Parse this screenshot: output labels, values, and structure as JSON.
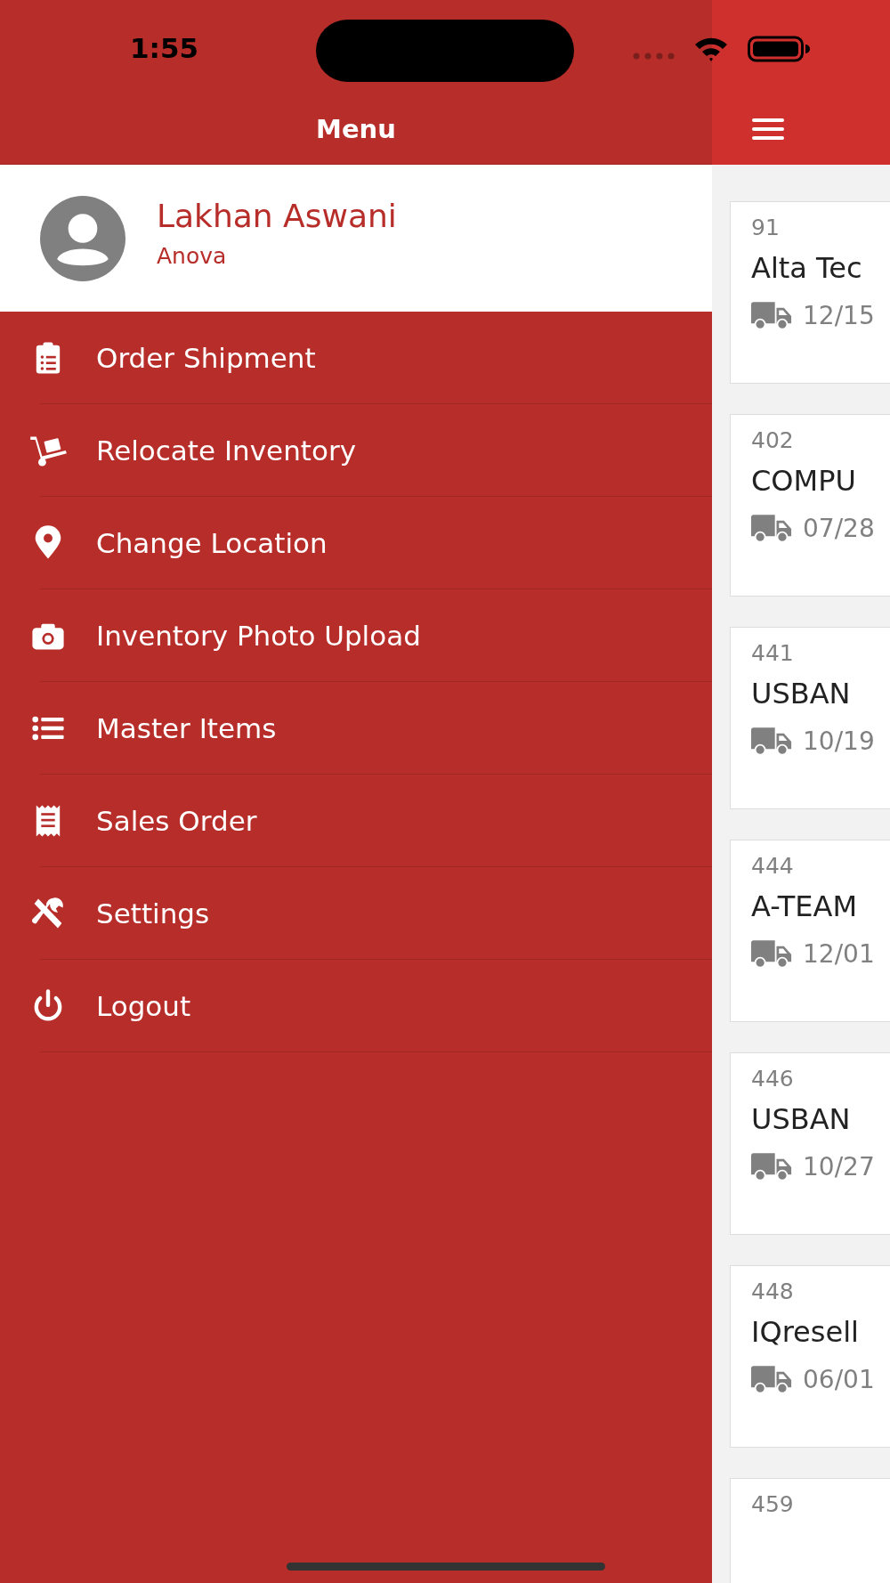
{
  "status_bar": {
    "time": "1:55"
  },
  "drawer": {
    "title": "Menu",
    "user": {
      "name": "Lakhan Aswani",
      "company": "Anova"
    },
    "items": [
      {
        "label": "Order Shipment",
        "kind": "clipboard"
      },
      {
        "label": "Relocate Inventory",
        "kind": "dolly"
      },
      {
        "label": "Change Location",
        "kind": "pin"
      },
      {
        "label": "Inventory Photo Upload",
        "kind": "camera"
      },
      {
        "label": "Master Items",
        "kind": "list"
      },
      {
        "label": "Sales Order",
        "kind": "receipt"
      },
      {
        "label": "Settings",
        "kind": "tools"
      },
      {
        "label": "Logout",
        "kind": "power"
      }
    ]
  },
  "orders": [
    {
      "number": "91",
      "name": "Alta Tec",
      "date": "12/15"
    },
    {
      "number": "402",
      "name": "COMPU",
      "date": "07/28"
    },
    {
      "number": "441",
      "name": "USBAN",
      "date": "10/19"
    },
    {
      "number": "444",
      "name": "A-TEAM",
      "date": "12/01"
    },
    {
      "number": "446",
      "name": "USBAN",
      "date": "10/27"
    },
    {
      "number": "448",
      "name": "IQresell",
      "date": "06/01"
    },
    {
      "number": "459"
    }
  ]
}
